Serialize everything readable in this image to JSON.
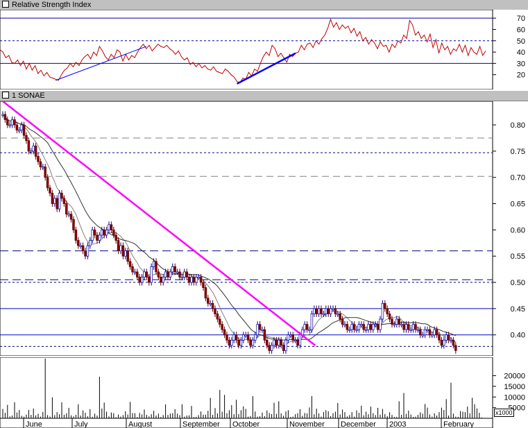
{
  "panels": {
    "rsi_title": "Relative Strength Index",
    "price_title": "1 SONAE",
    "volume_multiplier": "x1000"
  },
  "months": [
    "June",
    "July",
    "August",
    "September",
    "October",
    "November",
    "December",
    "2003",
    "February"
  ],
  "chart_data": [
    {
      "type": "line",
      "panel": "rsi",
      "title": "Relative Strength Index",
      "ylim": [
        10,
        75
      ],
      "yticks": [
        20,
        30,
        40,
        50,
        60,
        70
      ],
      "reference_lines": [
        30,
        50,
        70
      ],
      "values": [
        42,
        40,
        35,
        37,
        31,
        30,
        33,
        28,
        32,
        25,
        30,
        24,
        28,
        21,
        24,
        19,
        22,
        18,
        17,
        16,
        15,
        20,
        24,
        26,
        30,
        27,
        31,
        28,
        33,
        36,
        38,
        34,
        40,
        37,
        45,
        41,
        36,
        33,
        38,
        35,
        42,
        40,
        32,
        38,
        33,
        37,
        35,
        40,
        44,
        47,
        43,
        46,
        41,
        44,
        47,
        45,
        44,
        46,
        43,
        41,
        38,
        41,
        36,
        33,
        35,
        29,
        31,
        27,
        30,
        26,
        28,
        25,
        24,
        27,
        23,
        22,
        21,
        25,
        23,
        20,
        18,
        14,
        13,
        17,
        16,
        22,
        19,
        25,
        23,
        30,
        36,
        40,
        37,
        46,
        43,
        36,
        39,
        35,
        31,
        38,
        36,
        39,
        40,
        46,
        42,
        47,
        48,
        44,
        50,
        47,
        52,
        55,
        61,
        69,
        62,
        66,
        60,
        64,
        61,
        63,
        57,
        61,
        54,
        58,
        50,
        53,
        47,
        51,
        48,
        43,
        49,
        45,
        46,
        40,
        47,
        44,
        50,
        48,
        55,
        52,
        68,
        64,
        55,
        58,
        52,
        55,
        49,
        56,
        44,
        51,
        39,
        48,
        42,
        45,
        38,
        43,
        41,
        47,
        40,
        46,
        37,
        44,
        40,
        38,
        45,
        37,
        41
      ]
    },
    {
      "type": "candlestick",
      "panel": "price",
      "title": "1 SONAE",
      "ylim": [
        0.36,
        0.845
      ],
      "yticks": [
        0.4,
        0.45,
        0.5,
        0.55,
        0.6,
        0.65,
        0.7,
        0.75,
        0.8
      ],
      "ytick_labels": [
        "0.40",
        "0.45",
        "0.50",
        "0.55",
        "0.60",
        "0.65",
        "0.70",
        "0.75",
        "0.80"
      ],
      "close": [
        0.82,
        0.81,
        0.8,
        0.8,
        0.81,
        0.8,
        0.79,
        0.79,
        0.8,
        0.78,
        0.77,
        0.75,
        0.75,
        0.76,
        0.74,
        0.73,
        0.72,
        0.72,
        0.7,
        0.68,
        0.67,
        0.65,
        0.66,
        0.64,
        0.67,
        0.66,
        0.65,
        0.63,
        0.63,
        0.62,
        0.6,
        0.58,
        0.57,
        0.57,
        0.56,
        0.55,
        0.57,
        0.58,
        0.6,
        0.59,
        0.58,
        0.59,
        0.6,
        0.59,
        0.6,
        0.61,
        0.6,
        0.59,
        0.58,
        0.56,
        0.57,
        0.55,
        0.56,
        0.54,
        0.53,
        0.52,
        0.52,
        0.51,
        0.5,
        0.51,
        0.52,
        0.51,
        0.5,
        0.53,
        0.54,
        0.52,
        0.51,
        0.5,
        0.51,
        0.52,
        0.51,
        0.52,
        0.53,
        0.52,
        0.52,
        0.51,
        0.51,
        0.52,
        0.51,
        0.5,
        0.51,
        0.5,
        0.51,
        0.51,
        0.5,
        0.49,
        0.47,
        0.46,
        0.46,
        0.45,
        0.44,
        0.43,
        0.42,
        0.41,
        0.4,
        0.39,
        0.38,
        0.39,
        0.4,
        0.39,
        0.38,
        0.39,
        0.4,
        0.4,
        0.39,
        0.38,
        0.39,
        0.4,
        0.42,
        0.41,
        0.41,
        0.39,
        0.38,
        0.37,
        0.38,
        0.39,
        0.38,
        0.39,
        0.38,
        0.37,
        0.39,
        0.4,
        0.4,
        0.39,
        0.39,
        0.38,
        0.4,
        0.41,
        0.42,
        0.41,
        0.41,
        0.44,
        0.45,
        0.44,
        0.45,
        0.44,
        0.44,
        0.45,
        0.44,
        0.45,
        0.45,
        0.44,
        0.44,
        0.43,
        0.42,
        0.42,
        0.41,
        0.41,
        0.42,
        0.41,
        0.41,
        0.42,
        0.42,
        0.41,
        0.41,
        0.42,
        0.41,
        0.42,
        0.42,
        0.41,
        0.43,
        0.46,
        0.45,
        0.44,
        0.43,
        0.42,
        0.42,
        0.43,
        0.42,
        0.42,
        0.41,
        0.42,
        0.41,
        0.41,
        0.42,
        0.41,
        0.41,
        0.4,
        0.4,
        0.41,
        0.41,
        0.4,
        0.4,
        0.41,
        0.4,
        0.39,
        0.38,
        0.39,
        0.4,
        0.39,
        0.39,
        0.38,
        0.37
      ],
      "moving_averages": [
        "short",
        "long"
      ],
      "trendlines": [
        {
          "from": [
            0,
            0.845
          ],
          "to": [
            153,
            0.38
          ],
          "color": "#ff00ff"
        }
      ],
      "support_resistance": [
        0.775,
        0.747,
        0.702,
        0.56,
        0.505,
        0.5,
        0.45,
        0.4,
        0.378
      ]
    },
    {
      "type": "bar",
      "panel": "volume",
      "ylim": [
        0,
        28000
      ],
      "yticks": [
        5000,
        10000,
        15000,
        20000
      ],
      "ytick_labels": [
        "5000",
        "10000",
        "15000",
        "20000"
      ],
      "values": [
        4400,
        2600,
        6300,
        900,
        1300,
        7500,
        2700,
        3900,
        1200,
        800,
        1700,
        3900,
        1600,
        4600,
        1400,
        2100,
        800,
        3000,
        28000,
        1500,
        800,
        9800,
        1500,
        2900,
        1900,
        7500,
        1700,
        2300,
        4900,
        1400,
        900,
        1600,
        6600,
        1300,
        3700,
        2600,
        1000,
        4300,
        700,
        2200,
        1300,
        19500,
        4600,
        7400,
        3100,
        900,
        2700,
        2400,
        500,
        1800,
        800,
        1500,
        3300,
        1800,
        7700,
        2500,
        2400,
        600,
        2500,
        1800,
        4100,
        1600,
        900,
        1900,
        3500,
        1300,
        2200,
        600,
        1500,
        6500,
        1600,
        2200,
        2400,
        4300,
        2200,
        1500,
        6600,
        800,
        1300,
        1400,
        5800,
        600,
        700,
        1500,
        3200,
        1700,
        1700,
        3500,
        9600,
        1600,
        4800,
        2300,
        13300,
        3100,
        11000,
        2400,
        3800,
        6200,
        1900,
        8700,
        2000,
        3800,
        5600,
        4400,
        800,
        1000,
        10400,
        3200,
        800,
        1000,
        2700,
        1000,
        3700,
        2500,
        2000,
        7300,
        2100,
        8000,
        2300,
        1200,
        3200,
        3800,
        600,
        800,
        1900,
        2400,
        4300,
        1200,
        2500,
        2300,
        5100,
        10400,
        1900,
        4500,
        2300,
        800,
        2900,
        3800,
        3300,
        1000,
        2400,
        3100,
        7200,
        1800,
        4100,
        2900,
        900,
        1500,
        2900,
        800,
        3700,
        2600,
        5900,
        1400,
        3100,
        1900,
        5500,
        2400,
        1500,
        4900,
        1700,
        4400,
        2000,
        1000,
        2800,
        1600,
        600,
        700,
        8000,
        1600,
        11900,
        2100,
        3600,
        1800,
        700,
        800,
        1600,
        2800,
        2200,
        6700,
        5000,
        1800,
        800,
        2300,
        1300,
        2900,
        5000,
        3900,
        9000,
        1300,
        16700,
        2200,
        800,
        700,
        3400,
        3100,
        2900,
        5500,
        2300,
        9600,
        6600,
        4600,
        2600,
        400
      ]
    }
  ]
}
